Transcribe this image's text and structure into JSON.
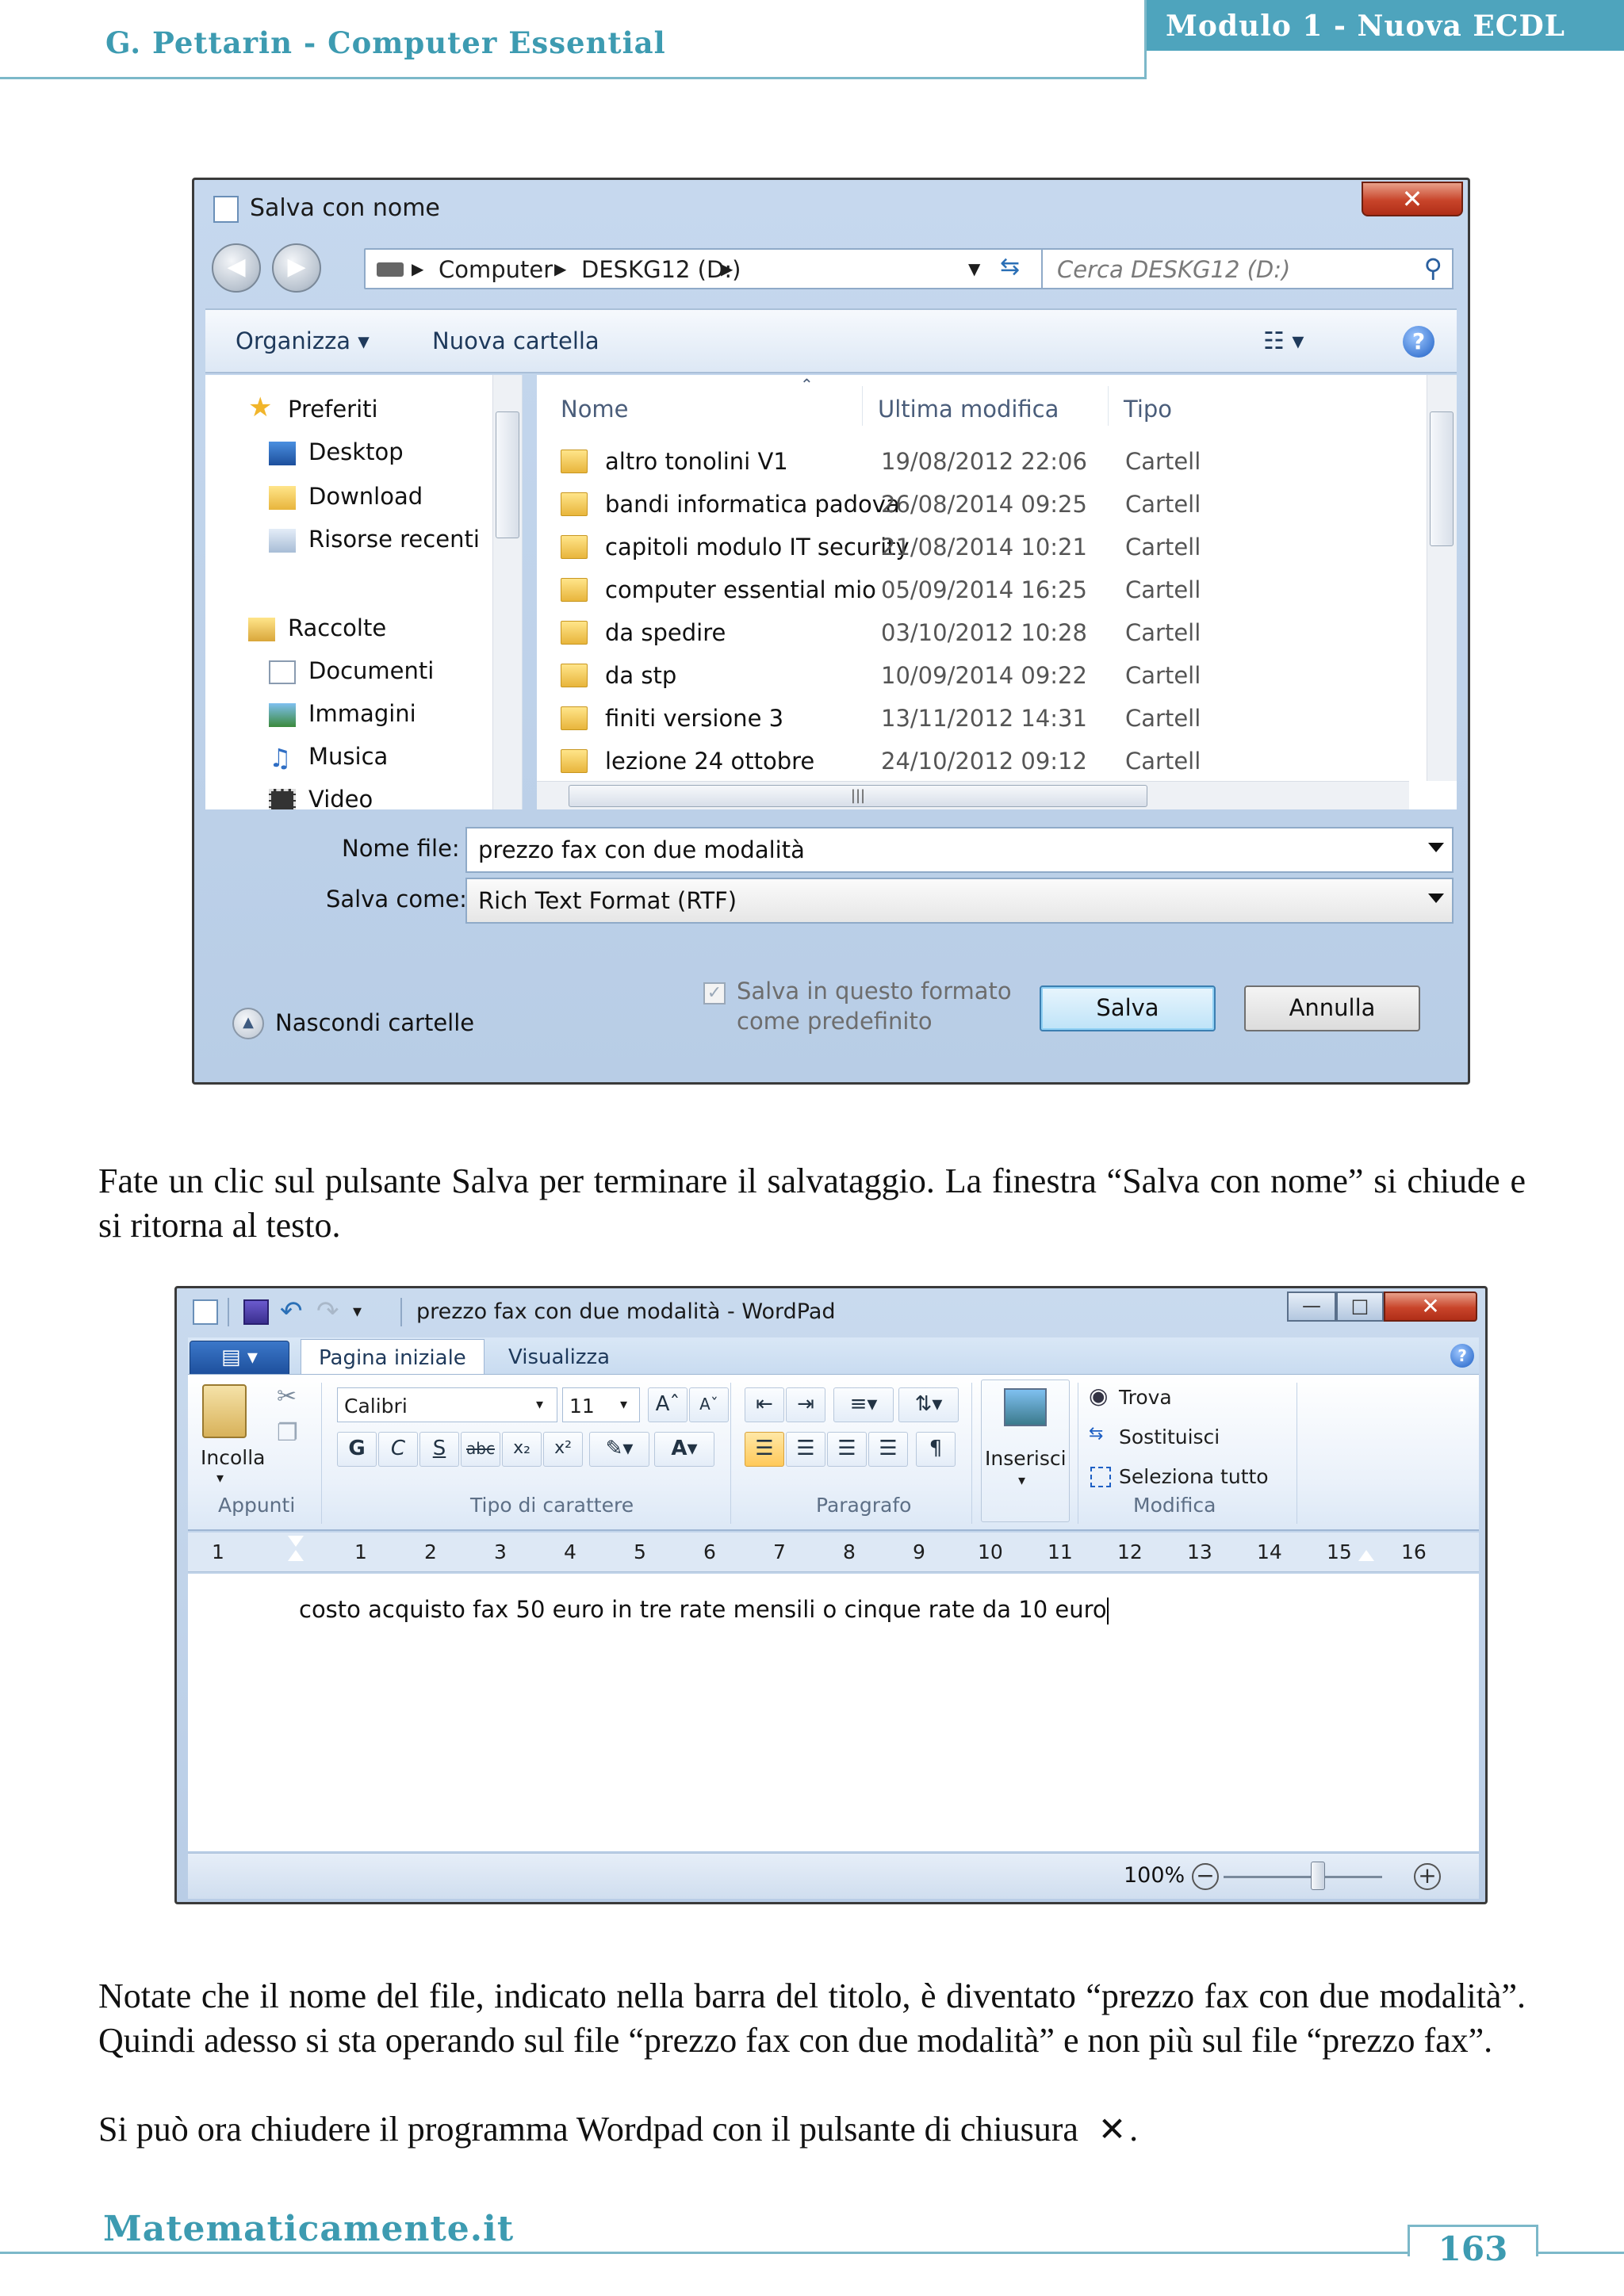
{
  "header": {
    "left_title": "G. Pettarin - Computer Essential",
    "right_title": "Modulo 1 - Nuova ECDL"
  },
  "save_dialog": {
    "title": "Salva con nome",
    "close_glyph": "✕",
    "breadcrumb": [
      "Computer",
      "DESKG12 (D:)"
    ],
    "search_placeholder": "Cerca DESKG12 (D:)",
    "toolbar": {
      "organize": "Organizza",
      "new_folder": "Nuova cartella"
    },
    "nav_pane": {
      "favorites": "Preferiti",
      "desktop": "Desktop",
      "downloads": "Download",
      "recent": "Risorse recenti",
      "libraries": "Raccolte",
      "documents": "Documenti",
      "pictures": "Immagini",
      "music": "Musica",
      "videos": "Video"
    },
    "columns": {
      "name": "Nome",
      "modified": "Ultima modifica",
      "type": "Tipo"
    },
    "rows": [
      {
        "name": "altro tonolini V1",
        "date": "19/08/2012 22:06",
        "type": "Cartell"
      },
      {
        "name": "bandi informatica padova",
        "date": "26/08/2014 09:25",
        "type": "Cartell"
      },
      {
        "name": "capitoli modulo IT security",
        "date": "21/08/2014 10:21",
        "type": "Cartell"
      },
      {
        "name": "computer essential mio",
        "date": "05/09/2014 16:25",
        "type": "Cartell"
      },
      {
        "name": "da spedire",
        "date": "03/10/2012 10:28",
        "type": "Cartell"
      },
      {
        "name": "da stp",
        "date": "10/09/2014 09:22",
        "type": "Cartell"
      },
      {
        "name": "finiti versione 3",
        "date": "13/11/2012 14:31",
        "type": "Cartell"
      },
      {
        "name": "lezione 24 ottobre",
        "date": "24/10/2012 09:12",
        "type": "Cartell"
      }
    ],
    "filename_label": "Nome file:",
    "filename_value": "prezzo fax con due modalità",
    "saveas_label": "Salva come:",
    "saveas_value": "Rich Text Format (RTF)",
    "default_format_line1": "Salva in questo formato",
    "default_format_line2": "come predefinito",
    "hide_folders": "Nascondi cartelle",
    "save_button": "Salva",
    "cancel_button": "Annulla"
  },
  "paragraph_1": "Fate un clic sul pulsante Salva per terminare il salvataggio. La finestra “Salva con nome” si chiude e si ritorna al testo.",
  "wordpad": {
    "title": "prezzo fax con due modalità - WordPad",
    "tabs": {
      "home": "Pagina iniziale",
      "view": "Visualizza"
    },
    "clipboard": {
      "paste": "Incolla",
      "group": "Appunti"
    },
    "font": {
      "name": "Calibri",
      "size": "11",
      "group": "Tipo di carattere",
      "bold": "G",
      "italic": "C",
      "underline": "S",
      "strike": "abc"
    },
    "paragraph_group": "Paragrafo",
    "insert": "Inserisci",
    "editing": {
      "find": "Trova",
      "replace": "Sostituisci",
      "select_all": "Seleziona tutto",
      "group": "Modifica"
    },
    "ruler_numbers": [
      "1",
      "1",
      "2",
      "3",
      "4",
      "5",
      "6",
      "7",
      "8",
      "9",
      "10",
      "11",
      "12",
      "13",
      "14",
      "15",
      "16"
    ],
    "document_text": "costo acquisto fax 50 euro in tre rate mensili o cinque rate da 10 euro",
    "zoom": "100%"
  },
  "paragraph_2": "Notate che il nome del file, indicato nella barra del titolo, è diventato “prezzo fax con due modalità”. Quindi adesso si sta operando sul file “prezzo fax con due modalità” e non più sul file “prezzo fax”.",
  "paragraph_3_before": "Si può ora chiudere il programma Wordpad con il pulsante di chiusura",
  "paragraph_3_after": ".",
  "footer": {
    "site": "Matematicamente.it",
    "page_number": "163"
  }
}
